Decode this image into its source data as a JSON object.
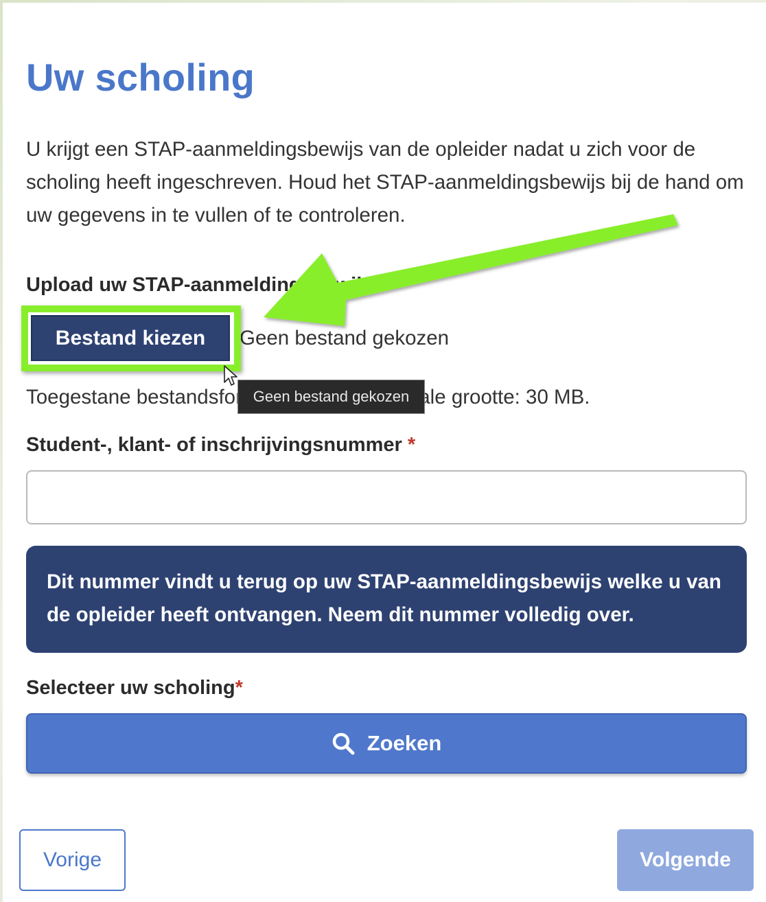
{
  "page": {
    "title": "Uw scholing",
    "intro": "U krijgt een STAP-aanmeldingsbewijs van de opleider nadat u zich voor de scholing heeft ingeschreven. Houd het STAP-aanmeldingsbewijs bij de hand om uw gegevens in te vullen of te controleren."
  },
  "upload": {
    "label": "Upload uw STAP-aanmeldingsbewijs",
    "button_label": "Bestand kiezen",
    "status": "Geen bestand gekozen",
    "allowed_text": "Toegestane bestandsformaten: PDF, maximale grootte: 30 MB.",
    "tooltip": "Geen bestand gekozen"
  },
  "student_number": {
    "label": "Student-, klant- of inschrijvingsnummer",
    "required_mark": "*",
    "value": ""
  },
  "info": {
    "text": "Dit nummer vindt u terug op uw STAP-aanmeldingsbewijs welke u van de opleider heeft ontvangen. Neem dit nummer volledig over."
  },
  "scholing": {
    "label": "Selecteer uw scholing",
    "required_mark": "*",
    "search_label": "Zoeken",
    "search_icon": "search-icon"
  },
  "navigation": {
    "prev_label": "Vorige",
    "next_label": "Volgende"
  },
  "colors": {
    "title": "#4a77c9",
    "dark_blue": "#2e4272",
    "primary": "#4f78cc",
    "disabled_primary": "#8fa9df",
    "annotation_green": "#88ee2c",
    "required": "#c0392b"
  }
}
